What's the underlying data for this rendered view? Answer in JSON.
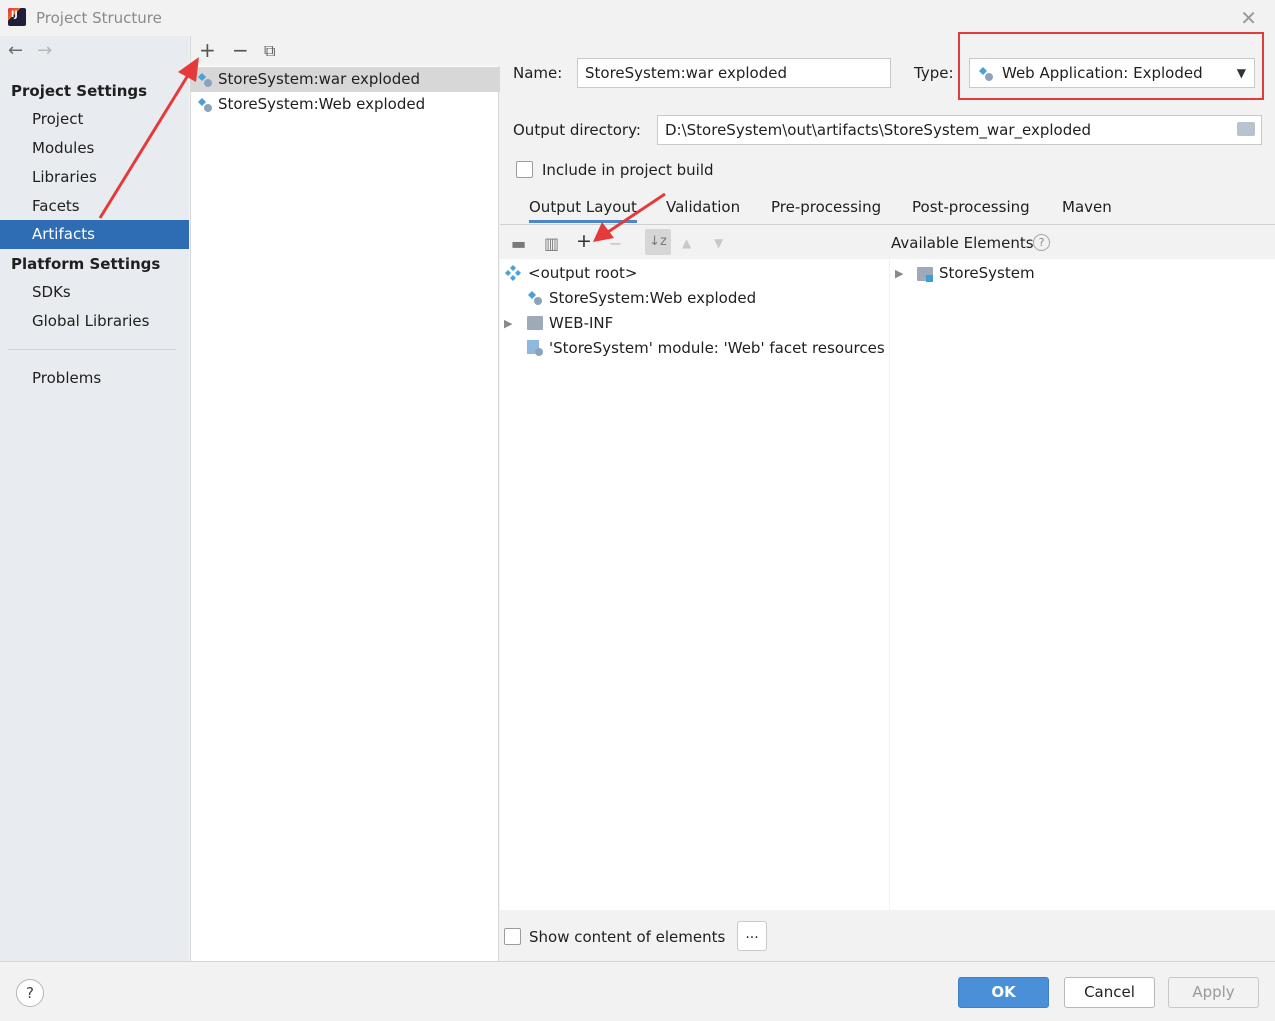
{
  "window": {
    "title": "Project Structure"
  },
  "sidebar": {
    "project_settings_heading": "Project Settings",
    "project_items": [
      "Project",
      "Modules",
      "Libraries",
      "Facets",
      "Artifacts"
    ],
    "platform_settings_heading": "Platform Settings",
    "platform_items": [
      "SDKs",
      "Global Libraries"
    ],
    "problems": "Problems",
    "selected": "Artifacts"
  },
  "artifacts": {
    "items": [
      "StoreSystem:war exploded",
      "StoreSystem:Web exploded"
    ],
    "selected_index": 0
  },
  "form": {
    "name_label": "Name:",
    "name_value": "StoreSystem:war exploded",
    "type_label": "Type:",
    "type_value": "Web Application: Exploded",
    "output_dir_label": "Output directory:",
    "output_dir_value": "D:\\StoreSystem\\out\\artifacts\\StoreSystem_war_exploded",
    "include_build_label": "Include in project build",
    "include_build_checked": false
  },
  "tabs": [
    "Output Layout",
    "Validation",
    "Pre-processing",
    "Post-processing",
    "Maven"
  ],
  "active_tab": "Output Layout",
  "layout_tree": [
    "<output root>",
    "StoreSystem:Web exploded",
    "WEB-INF",
    "'StoreSystem' module: 'Web' facet resources"
  ],
  "available": {
    "header": "Available Elements",
    "items": [
      "StoreSystem"
    ]
  },
  "options": {
    "show_content_label": "Show content of elements",
    "show_content_checked": false,
    "dots_label": "..."
  },
  "footer": {
    "help_label": "?",
    "ok_label": "OK",
    "cancel_label": "Cancel",
    "apply_label": "Apply"
  },
  "colors": {
    "selection": "#2e6db4",
    "ok_button": "#4a90d9",
    "annotation": "#e53a3a"
  }
}
